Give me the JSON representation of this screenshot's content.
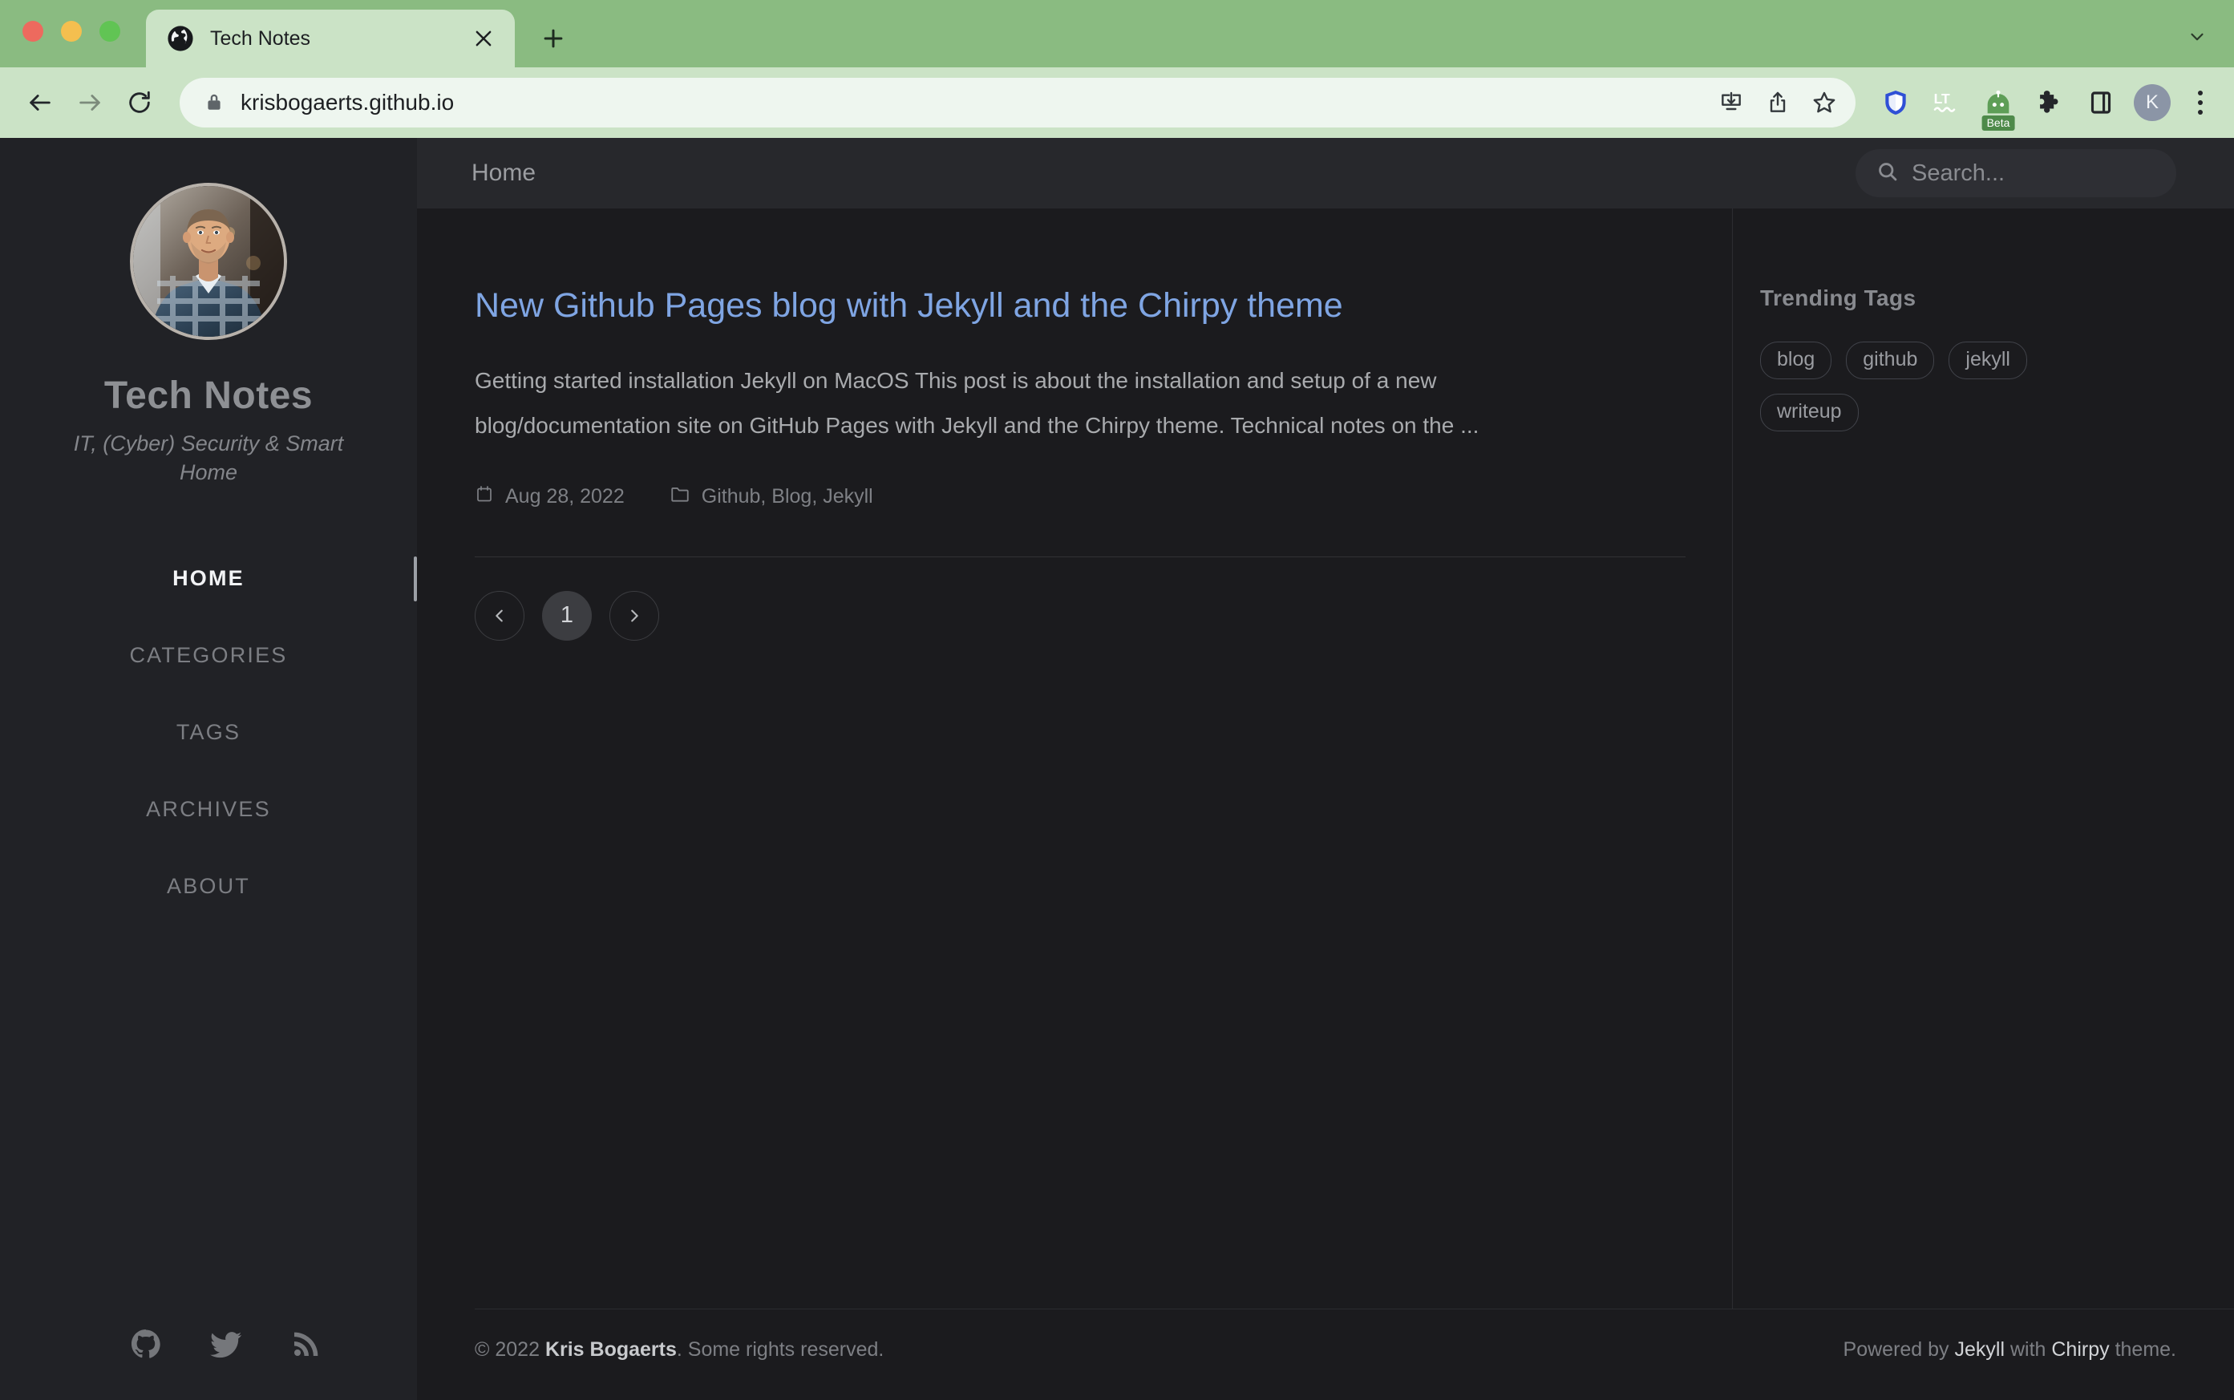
{
  "browser": {
    "tab": {
      "title": "Tech Notes",
      "favicon_icon": "globe-icon",
      "close_icon": "close-icon"
    },
    "new_tab_label": "+",
    "tabstrip_overflow_icon": "chevron-down-icon",
    "nav": {
      "back_icon": "back-arrow-icon",
      "forward_icon": "forward-arrow-icon",
      "reload_icon": "reload-icon"
    },
    "omnibox": {
      "lock_icon": "lock-icon",
      "url": "krisbogaerts.github.io",
      "actions": [
        "install-icon",
        "share-icon",
        "bookmark-star-icon"
      ]
    },
    "extensions": [
      {
        "name": "ublock-shield-icon",
        "label": ""
      },
      {
        "name": "languagetool-icon",
        "label": "LT"
      },
      {
        "name": "beta-robot-icon",
        "label": "Beta"
      },
      {
        "name": "extensions-puzzle-icon",
        "label": ""
      },
      {
        "name": "side-panel-icon",
        "label": ""
      }
    ],
    "profile": {
      "initial": "K",
      "icon": "avatar-icon"
    },
    "menu_icon": "kebab-menu-icon",
    "colors": {
      "tabstrip": "#8abb81",
      "toolbar": "#cbe3c6",
      "omnibox": "#eef6ef",
      "tab_active": "#cbe3c6"
    }
  },
  "site": {
    "sidebar": {
      "avatar_icon": "profile-photo",
      "title": "Tech Notes",
      "tagline": "IT, (Cyber) Security & Smart Home",
      "nav": [
        {
          "label": "HOME",
          "active": true
        },
        {
          "label": "CATEGORIES",
          "active": false
        },
        {
          "label": "TAGS",
          "active": false
        },
        {
          "label": "ARCHIVES",
          "active": false
        },
        {
          "label": "ABOUT",
          "active": false
        }
      ],
      "social": [
        {
          "name": "github-icon"
        },
        {
          "name": "twitter-icon"
        },
        {
          "name": "rss-icon"
        }
      ]
    },
    "topbar": {
      "breadcrumb": "Home",
      "search": {
        "icon": "search-icon",
        "placeholder": "Search...",
        "value": ""
      }
    },
    "posts": [
      {
        "title": "New Github Pages blog with Jekyll and the Chirpy theme",
        "excerpt": "Getting started installation Jekyll on MacOS This post is about the installation and setup of a new blog/documentation site on GitHub Pages with Jekyll and the Chirpy theme. Technical notes on the ...",
        "date": "Aug 28, 2022",
        "date_icon": "calendar-icon",
        "categories": "Github, Blog, Jekyll",
        "categories_icon": "folder-icon"
      }
    ],
    "pagination": {
      "prev_icon": "chevron-left-icon",
      "next_icon": "chevron-right-icon",
      "current_page": "1"
    },
    "rail": {
      "title": "Trending Tags",
      "tags": [
        "blog",
        "github",
        "jekyll",
        "writeup"
      ]
    },
    "footer": {
      "copyright_prefix": "© 2022 ",
      "copyright_name": "Kris Bogaerts",
      "copyright_suffix": ". Some rights reserved.",
      "powered_prefix": "Powered by ",
      "powered_engine": "Jekyll",
      "powered_mid": " with ",
      "powered_theme": "Chirpy",
      "powered_suffix": " theme."
    },
    "colors": {
      "sidebar_bg": "#212226",
      "content_bg": "#1b1b1e",
      "topbar_bg": "#27282c",
      "link": "#7fa5e3"
    }
  }
}
